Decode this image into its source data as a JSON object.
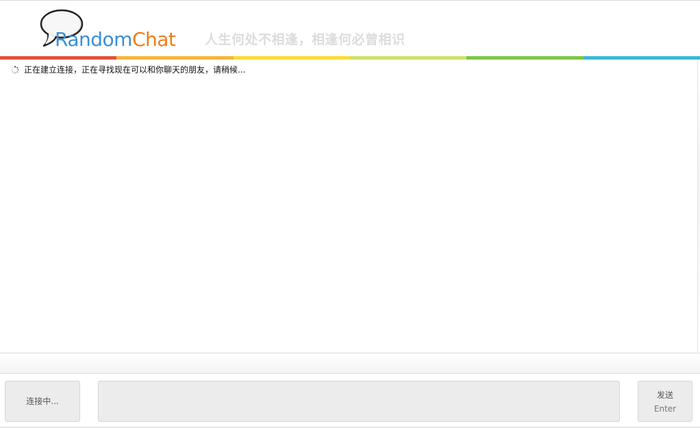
{
  "header": {
    "logo": {
      "icon": "speech-bubble-icon",
      "text_part1": "Random",
      "text_part2": "Chat",
      "color_part1": "#3a8fd6",
      "color_part2": "#f07c16"
    },
    "slogan": "人生何处不相逢，相逢何必曾相识"
  },
  "color_bar": {
    "colors": [
      "#e0533f",
      "#f5b63c",
      "#f9dc3a",
      "#cfe06a",
      "#7dc646",
      "#3cb7d3"
    ]
  },
  "chat": {
    "status_icon": "loading-spinner-icon",
    "status_text": "正在建立连接，正在寻找现在可以和你聊天的朋友，请稍候..."
  },
  "input_bar": {
    "connect_button_label": "连接中...",
    "message_value": "",
    "send_button_label": "发送",
    "send_button_hint": "Enter"
  }
}
